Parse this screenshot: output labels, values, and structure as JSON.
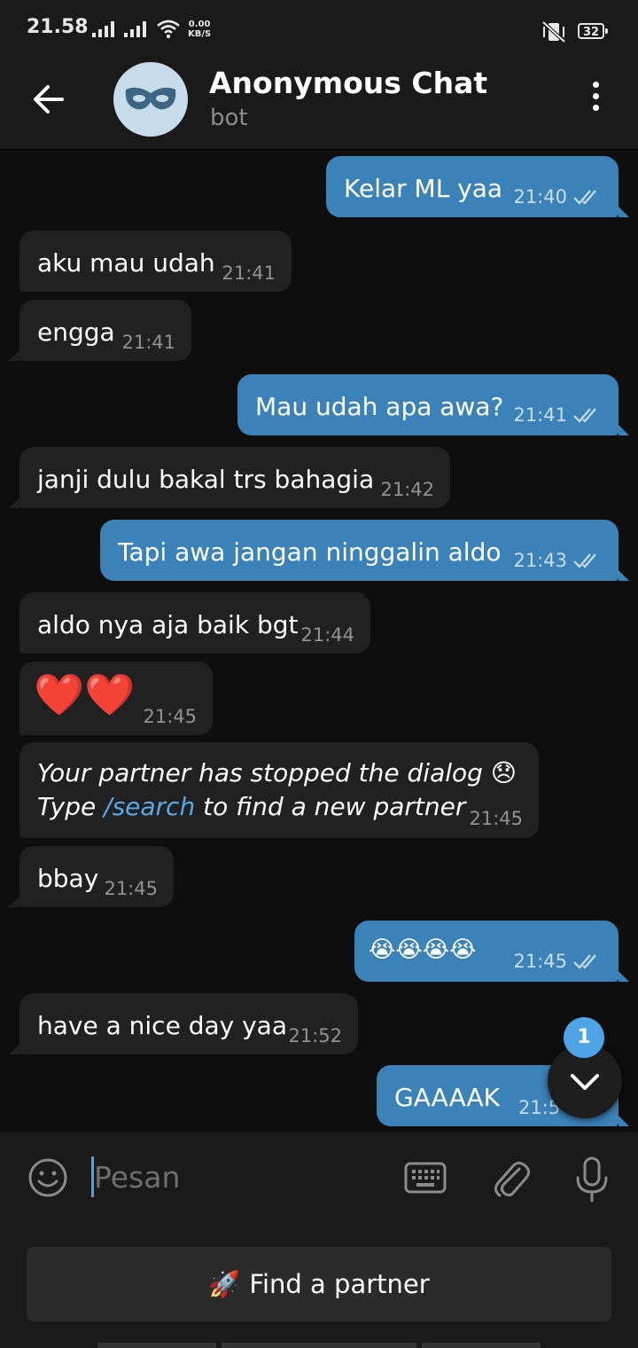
{
  "status_bar": {
    "time": "21.58",
    "net_speed_value": "0.00",
    "net_speed_unit": "KB/S",
    "battery": "32"
  },
  "header": {
    "title": "Anonymous Chat",
    "subtitle": "bot"
  },
  "messages": [
    {
      "dir": "out",
      "text": "Kelar ML yaa",
      "time": "21:40"
    },
    {
      "dir": "in",
      "text": "aku mau udah",
      "time": "21:41"
    },
    {
      "dir": "in",
      "text": "engga",
      "time": "21:41"
    },
    {
      "dir": "out",
      "text": "Mau udah apa awa?",
      "time": "21:41"
    },
    {
      "dir": "in",
      "text": "janji dulu bakal trs bahagia",
      "time": "21:42"
    },
    {
      "dir": "out",
      "text": "Tapi awa jangan ninggalin aldo",
      "time": "21:43"
    },
    {
      "dir": "in",
      "text": "aldo nya aja baik bgt",
      "time": "21:44"
    },
    {
      "dir": "in",
      "text": "❤️❤️",
      "time": "21:45"
    },
    {
      "dir": "in",
      "line1": "Your partner has stopped the dialog 😞",
      "line2_pre": "Type ",
      "line2_link": "/search",
      "line2_post": " to find a new partner",
      "time": "21:45"
    },
    {
      "dir": "in",
      "text": "bbay",
      "time": "21:45"
    },
    {
      "dir": "out",
      "text": "😭😭😭😭",
      "time": "21:45"
    },
    {
      "dir": "in",
      "text": "have a nice day yaa",
      "time": "21:52"
    },
    {
      "dir": "out",
      "text": "GAAAAK",
      "time": "21:5"
    }
  ],
  "scroll_button": {
    "unread_count": "1"
  },
  "composer": {
    "placeholder": "Pesan"
  },
  "bot_keyboard": {
    "button_emoji": "🚀",
    "button_label": "Find a partner"
  },
  "colors": {
    "outgoing_bubble": "#3b82b8",
    "incoming_bubble": "#212121",
    "accent": "#4ea4e6"
  }
}
